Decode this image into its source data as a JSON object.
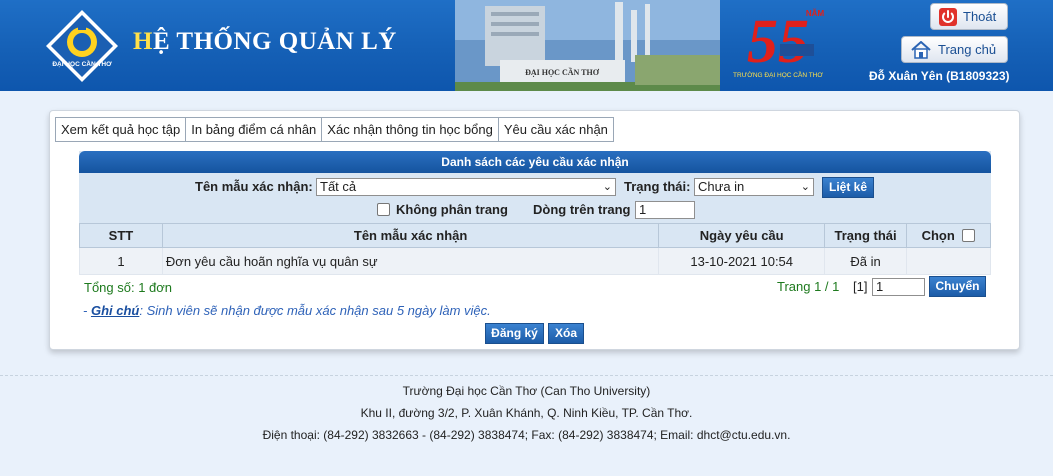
{
  "header": {
    "title_first": "H",
    "title_rest": "Ệ THỐNG QUẢN LÝ",
    "logo_text": "ĐẠI HỌC CẦN THƠ",
    "campus_sign": "ĐẠI HỌC CẦN THƠ",
    "anniversary_number": "55",
    "anniversary_word": "NĂM",
    "anniversary_text": "TRƯỜNG ĐẠI HỌC CẦN THƠ",
    "logout_label": "Thoát",
    "home_label": "Trang chủ",
    "user": "Đỗ Xuân Yên (B1809323)",
    "colors": {
      "header_blue": "#1560b6",
      "title_accent": "#ffe14a",
      "anniversary_red": "#e0201b"
    }
  },
  "tabs": [
    {
      "label": "Xem kết quả học tập"
    },
    {
      "label": "In bảng điểm cá nhân"
    },
    {
      "label": "Xác nhận thông tin học bổng"
    },
    {
      "label": "Yêu cầu xác nhận"
    }
  ],
  "list": {
    "title": "Danh sách các yêu cầu xác nhận",
    "template_label": "Tên mẫu xác nhận:",
    "template_value": "Tất cả",
    "status_label": "Trạng thái:",
    "status_value": "Chưa in",
    "list_button": "Liệt kê",
    "no_paging_label": "Không phân trang",
    "rows_per_page_label": "Dòng trên trang",
    "rows_per_page_value": "1",
    "columns": [
      "STT",
      "Tên mẫu xác nhận",
      "Ngày yêu cầu",
      "Trạng thái",
      "Chọn"
    ],
    "rows": [
      {
        "stt": "1",
        "name": "Đơn yêu cầu hoãn nghĩa vụ quân sự",
        "date": "13-10-2021 10:54",
        "status": "Đã in"
      }
    ],
    "total": "Tổng số: 1 đơn",
    "page_info": "Trang 1 / 1",
    "page_bracket": "[1]",
    "page_input": "1",
    "go_button": "Chuyển"
  },
  "note": {
    "prefix": "- ",
    "label": "Ghi chú",
    "text": ": Sinh viên sẽ nhận được mẫu xác nhận sau 5 ngày làm việc."
  },
  "actions": {
    "register": "Đăng ký",
    "delete": "Xóa"
  },
  "footer": {
    "line1": "Trường Đại học Cần Thơ (Can Tho University)",
    "line2": "Khu II, đường 3/2, P. Xuân Khánh, Q. Ninh Kiều, TP. Cần Thơ.",
    "line3": "Điện thoại: (84-292) 3832663 - (84-292) 3838474; Fax: (84-292) 3838474; Email: dhct@ctu.edu.vn."
  }
}
